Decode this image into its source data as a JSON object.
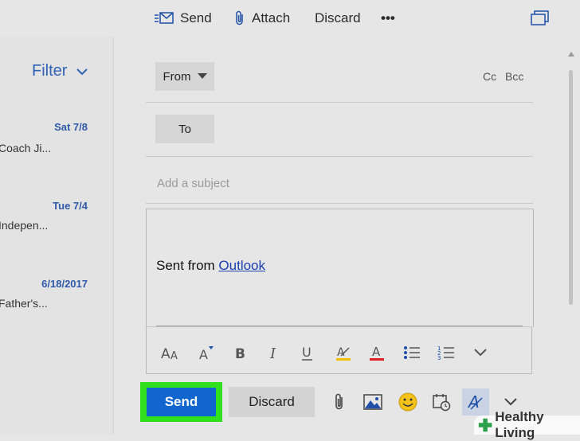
{
  "toolbar": {
    "send_label": "Send",
    "attach_label": "Attach",
    "discard_label": "Discard",
    "more_label": "•••"
  },
  "mail_list": {
    "filter_label": "Filter",
    "items": [
      {
        "date": "Sat 7/8",
        "snippet": "Coach Ji..."
      },
      {
        "date": "Tue 7/4",
        "snippet": "Indepen..."
      },
      {
        "date": "6/18/2017",
        "snippet": "Father's..."
      }
    ]
  },
  "compose": {
    "from_label": "From",
    "cc_label": "Cc",
    "bcc_label": "Bcc",
    "to_label": "To",
    "subject_placeholder": "Add a subject",
    "body_text": "Sent from ",
    "body_link": "Outlook"
  },
  "format_bar": {
    "items": [
      "font-size-icon",
      "text-grow-icon",
      "bold-icon",
      "italic-icon",
      "underline-icon",
      "highlight-icon",
      "font-color-icon",
      "bullet-list-icon",
      "numbered-list-icon",
      "chevron-down-icon"
    ],
    "highlight_color": "#f0c000",
    "font_color": "#e02020"
  },
  "actions": {
    "send_label": "Send",
    "discard_label": "Discard"
  },
  "colors": {
    "accent": "#1165cf",
    "send_highlight": "#31e01c",
    "link": "#2f62b5"
  },
  "watermark": {
    "text": "Healthy Living"
  }
}
